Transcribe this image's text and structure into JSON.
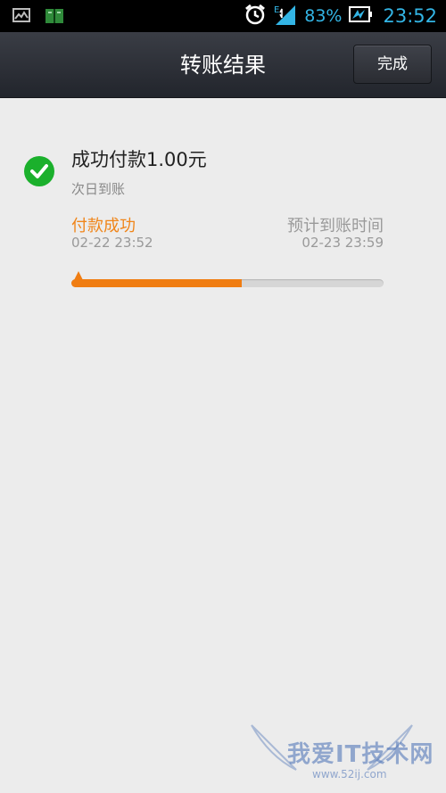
{
  "status_bar": {
    "battery_percent": "83%",
    "time": "23:52",
    "network_type": "E",
    "icons": [
      "gallery-icon",
      "reader-icon",
      "alarm-icon",
      "signal-icon",
      "battery-icon"
    ]
  },
  "header": {
    "title": "转账结果",
    "done_label": "完成"
  },
  "result": {
    "title": "成功付款1.00元",
    "subtitle": "次日到账",
    "step_left_label": "付款成功",
    "step_left_time": "02-22 23:52",
    "step_right_label": "预计到账时间",
    "step_right_time": "02-23 23:59",
    "progress_fraction": 0.545
  },
  "watermark": {
    "text": "我爱IT技术网",
    "url": "www.52ij.com"
  },
  "colors": {
    "accent": "#f07d12",
    "success": "#1bb02c",
    "status_blue": "#33b5e5"
  }
}
